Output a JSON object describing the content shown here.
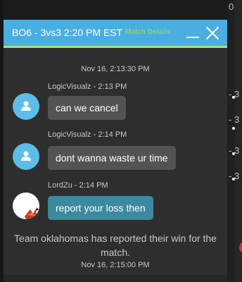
{
  "header": {
    "title": "BO6 - 3vs3  2:20 PM EST",
    "details_link": "Match Details"
  },
  "chat": {
    "timestamp_top": "Nov 16, 2:13:30 PM",
    "messages": [
      {
        "author": "LogicVisualz - 2:13 PM",
        "text": "can we cancel",
        "own": false
      },
      {
        "author": "LogicVisualz - 2:14 PM",
        "text": "dont wanna waste ur time",
        "own": false
      },
      {
        "author": "LordZu - 2:14 PM",
        "text": "report your loss then",
        "own": true
      }
    ],
    "system_message": "Team oklahomas has reported their win for the match.",
    "timestamp_bottom": "Nov 16, 2:15:00 PM"
  },
  "background": {
    "fragments": [
      "0",
      "- 3",
      "- 3",
      "- 3",
      "- 3"
    ]
  },
  "colors": {
    "header": "#4aaee0",
    "header_border": "#a6e06a",
    "own_bubble": "#3b8aa0",
    "other_bubble": "#535353",
    "avatar": "#5ebde6"
  }
}
